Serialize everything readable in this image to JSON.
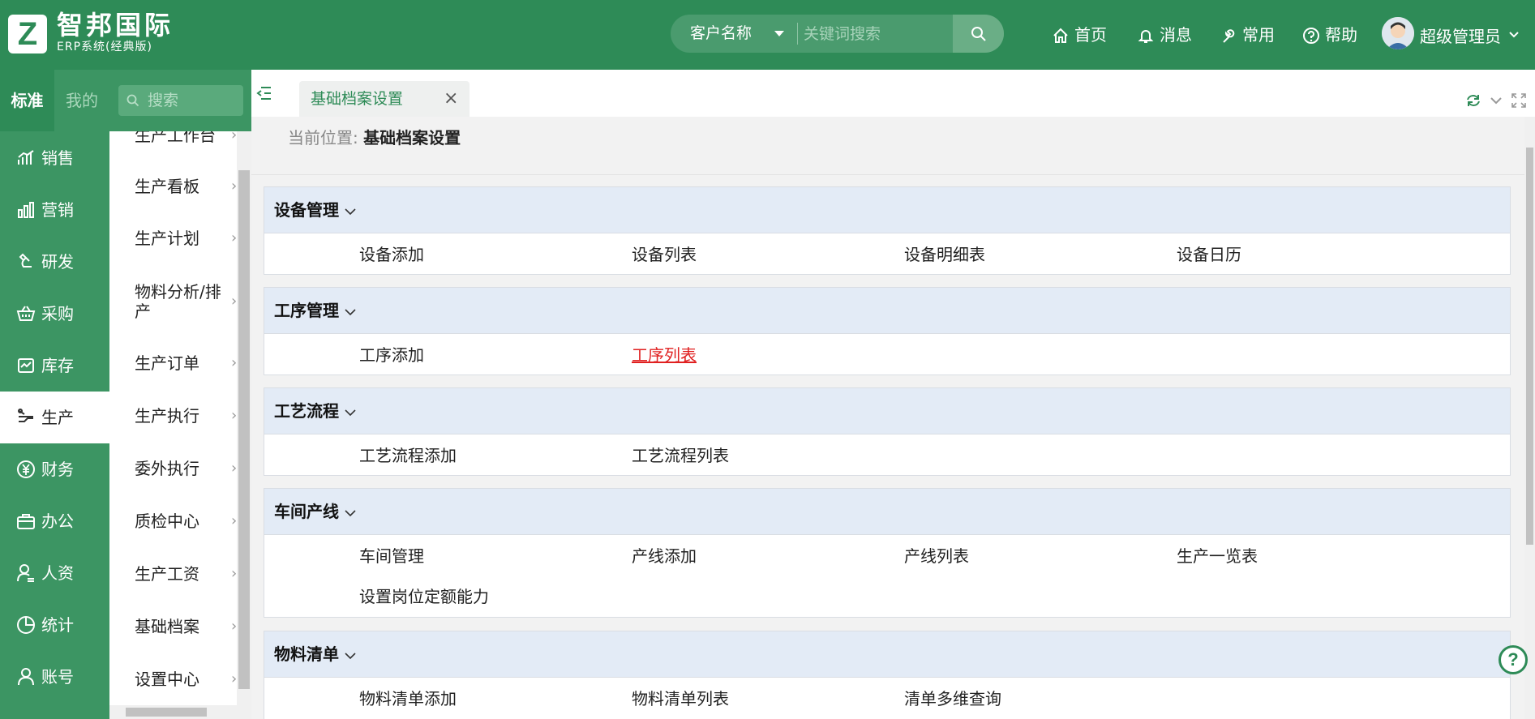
{
  "brand": {
    "logo_letter": "Z",
    "name": "智邦国际",
    "subtitle": "ERP系统(经典版)"
  },
  "header": {
    "search": {
      "type_label": "客户名称",
      "placeholder": "关键词搜索"
    },
    "nav": [
      {
        "label": "首页",
        "icon": "home-icon"
      },
      {
        "label": "消息",
        "icon": "bell-icon"
      },
      {
        "label": "常用",
        "icon": "wrench-icon"
      },
      {
        "label": "帮助",
        "icon": "question-circle-icon"
      }
    ],
    "user": {
      "name": "超级管理员"
    }
  },
  "sidebar": {
    "tabs": {
      "standard": "标准",
      "mine": "我的"
    },
    "search_placeholder": "搜索",
    "modules": [
      {
        "label": "销售",
        "icon": "sales-chart-icon"
      },
      {
        "label": "营销",
        "icon": "bar-chart-icon"
      },
      {
        "label": "研发",
        "icon": "rnd-icon"
      },
      {
        "label": "采购",
        "icon": "basket-icon"
      },
      {
        "label": "库存",
        "icon": "inventory-icon"
      },
      {
        "label": "生产",
        "icon": "production-icon",
        "active": true
      },
      {
        "label": "财务",
        "icon": "yuan-icon"
      },
      {
        "label": "办公",
        "icon": "briefcase-icon"
      },
      {
        "label": "人资",
        "icon": "person-icon"
      },
      {
        "label": "统计",
        "icon": "pie-icon"
      },
      {
        "label": "账号",
        "icon": "user-icon"
      }
    ],
    "submenu": [
      "生产工作台",
      "生产看板",
      "生产计划",
      "物料分析/排产",
      "生产订单",
      "生产执行",
      "委外执行",
      "质检中心",
      "生产工资",
      "基础档案",
      "设置中心"
    ]
  },
  "tabs": {
    "open": [
      {
        "label": "基础档案设置",
        "close": "×"
      }
    ]
  },
  "main": {
    "breadcrumb": {
      "label": "当前位置:",
      "value": "基础档案设置"
    },
    "sections": [
      {
        "title": "设备管理",
        "links": [
          "设备添加",
          "设备列表",
          "设备明细表",
          "设备日历"
        ]
      },
      {
        "title": "工序管理",
        "links": [
          "工序添加",
          "工序列表"
        ],
        "active_link": "工序列表"
      },
      {
        "title": "工艺流程",
        "links": [
          "工艺流程添加",
          "工艺流程列表"
        ]
      },
      {
        "title": "车间产线",
        "links": [
          "车间管理",
          "产线添加",
          "产线列表",
          "生产一览表",
          "设置岗位定额能力"
        ]
      },
      {
        "title": "物料清单",
        "links": [
          "物料清单添加",
          "物料清单列表",
          "清单多维查询"
        ]
      }
    ]
  },
  "help_fab": "?",
  "colors": {
    "primary": "#2e8b57",
    "sidebar": "#3c9563",
    "panel_header": "#e3ebf6",
    "active_link": "#e02020"
  }
}
